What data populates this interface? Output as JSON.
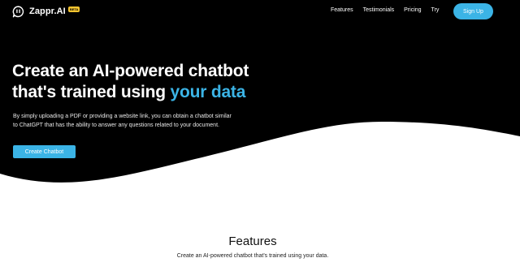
{
  "brand": {
    "name": "Zappr.AI",
    "badge": "BETA"
  },
  "nav": {
    "links": [
      "Features",
      "Testimonials",
      "Pricing",
      "Try"
    ],
    "signup_label": "Sign Up"
  },
  "hero": {
    "headline_line1": "Create an AI-powered chatbot",
    "headline_line2_prefix": "that's trained using ",
    "headline_line2_accent": "your data",
    "description_line1": "By simply uploading a PDF or providing a website link, you can obtain a chatbot similar",
    "description_line2": "to ChatGPT that has the ability to answer any questions related to your document.",
    "cta_label": "Create Chatbot"
  },
  "features": {
    "title": "Features",
    "subtitle": "Create an AI-powered chatbot that's trained using your data."
  },
  "colors": {
    "accent": "#3bb4e6",
    "hero_bg": "#000000",
    "badge": "#f4c430"
  }
}
